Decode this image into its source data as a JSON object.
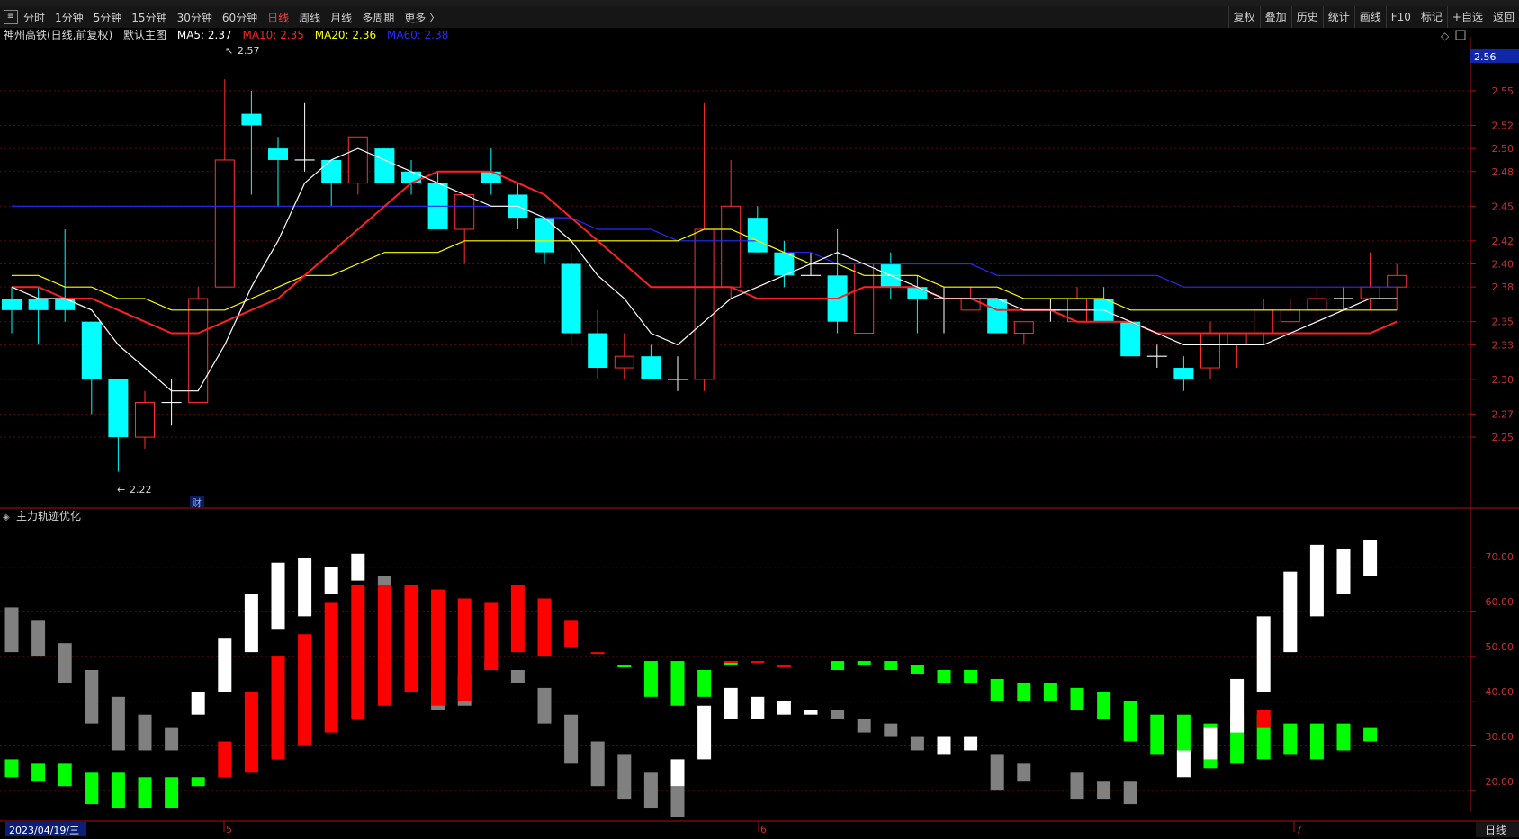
{
  "toolbar": {
    "periods": [
      "分时",
      "1分钟",
      "5分钟",
      "15分钟",
      "30分钟",
      "60分钟",
      "日线",
      "周线",
      "月线",
      "多周期",
      "更多 〉"
    ],
    "active_index": 6,
    "right_buttons": [
      "复权",
      "叠加",
      "历史",
      "统计",
      "画线",
      "F10",
      "标记",
      "+自选",
      "返回"
    ]
  },
  "main_panel": {
    "title": "神州高铁(日线,前复权)",
    "subtitle": "默认主图",
    "ma": [
      {
        "label": "MA5: 2.37",
        "color": "#ffffff"
      },
      {
        "label": "MA10: 2.35",
        "color": "#ff2020"
      },
      {
        "label": "MA20: 2.36",
        "color": "#ffff00"
      },
      {
        "label": "MA60: 2.38",
        "color": "#2a2aff"
      }
    ],
    "price_tag": "2.56",
    "high_label": "2.57",
    "low_label": "2.22",
    "fin_marker": "财",
    "top_right_icons": [
      "diamond-icon",
      "restore-icon"
    ]
  },
  "sub_panel": {
    "title": "主力轨迹优化",
    "y_ticks": [
      "70.00",
      "60.00",
      "50.00",
      "40.00",
      "30.00",
      "20.00"
    ]
  },
  "bottom_bar": {
    "date": "2023/04/19/三",
    "month_marks": [
      "5",
      "6",
      "7"
    ],
    "period_label": "日线"
  },
  "colors": {
    "up": "#ff3030",
    "down": "#00ffff",
    "ma5": "#ffffff",
    "ma10": "#ff2020",
    "ma20": "#ffff00",
    "ma60": "#2a2aff",
    "axis": "#b01010",
    "red_bar": "#ff0000",
    "green_bar": "#00ff00",
    "gray_bar": "#808080",
    "white_bar": "#ffffff"
  },
  "chart_data": [
    {
      "type": "candlestick",
      "title": "神州高铁(日线,前复权)",
      "y_ticks": [
        2.55,
        2.52,
        2.5,
        2.48,
        2.45,
        2.42,
        2.4,
        2.38,
        2.35,
        2.33,
        2.3,
        2.27,
        2.25
      ],
      "ylim": [
        2.215,
        2.592
      ],
      "candles": [
        [
          2.37,
          2.36,
          2.38,
          2.34
        ],
        [
          2.37,
          2.36,
          2.38,
          2.33
        ],
        [
          2.37,
          2.36,
          2.43,
          2.35
        ],
        [
          2.35,
          2.3,
          2.35,
          2.27
        ],
        [
          2.3,
          2.25,
          2.3,
          2.22
        ],
        [
          2.25,
          2.28,
          2.29,
          2.24
        ],
        [
          2.28,
          2.28,
          2.3,
          2.26
        ],
        [
          2.28,
          2.37,
          2.38,
          2.28
        ],
        [
          2.38,
          2.49,
          2.56,
          2.38
        ],
        [
          2.53,
          2.52,
          2.55,
          2.46
        ],
        [
          2.5,
          2.49,
          2.51,
          2.45
        ],
        [
          2.49,
          2.49,
          2.54,
          2.48
        ],
        [
          2.49,
          2.47,
          2.49,
          2.45
        ],
        [
          2.47,
          2.51,
          2.51,
          2.46
        ],
        [
          2.5,
          2.47,
          2.5,
          2.47
        ],
        [
          2.48,
          2.47,
          2.49,
          2.46
        ],
        [
          2.47,
          2.43,
          2.48,
          2.43
        ],
        [
          2.43,
          2.46,
          2.46,
          2.4
        ],
        [
          2.48,
          2.47,
          2.5,
          2.46
        ],
        [
          2.46,
          2.44,
          2.47,
          2.43
        ],
        [
          2.44,
          2.41,
          2.44,
          2.4
        ],
        [
          2.4,
          2.34,
          2.41,
          2.33
        ],
        [
          2.34,
          2.31,
          2.36,
          2.3
        ],
        [
          2.31,
          2.32,
          2.34,
          2.3
        ],
        [
          2.32,
          2.3,
          2.33,
          2.3
        ],
        [
          2.3,
          2.3,
          2.32,
          2.29
        ],
        [
          2.3,
          2.43,
          2.54,
          2.29
        ],
        [
          2.38,
          2.45,
          2.49,
          2.37
        ],
        [
          2.44,
          2.41,
          2.45,
          2.41
        ],
        [
          2.41,
          2.39,
          2.42,
          2.38
        ],
        [
          2.39,
          2.39,
          2.41,
          2.39
        ],
        [
          2.39,
          2.35,
          2.43,
          2.34
        ],
        [
          2.34,
          2.4,
          2.4,
          2.34
        ],
        [
          2.4,
          2.38,
          2.41,
          2.37
        ],
        [
          2.38,
          2.37,
          2.39,
          2.34
        ],
        [
          2.37,
          2.37,
          2.38,
          2.34
        ],
        [
          2.36,
          2.37,
          2.38,
          2.36
        ],
        [
          2.37,
          2.34,
          2.37,
          2.34
        ],
        [
          2.34,
          2.35,
          2.35,
          2.33
        ],
        [
          2.36,
          2.36,
          2.37,
          2.35
        ],
        [
          2.35,
          2.37,
          2.38,
          2.35
        ],
        [
          2.37,
          2.35,
          2.38,
          2.35
        ],
        [
          2.35,
          2.32,
          2.35,
          2.32
        ],
        [
          2.32,
          2.32,
          2.33,
          2.31
        ],
        [
          2.31,
          2.3,
          2.32,
          2.29
        ],
        [
          2.31,
          2.34,
          2.35,
          2.3
        ],
        [
          2.33,
          2.34,
          2.34,
          2.31
        ],
        [
          2.34,
          2.36,
          2.37,
          2.33
        ],
        [
          2.35,
          2.36,
          2.37,
          2.35
        ],
        [
          2.36,
          2.37,
          2.38,
          2.35
        ],
        [
          2.37,
          2.37,
          2.38,
          2.36
        ],
        [
          2.37,
          2.38,
          2.41,
          2.36
        ],
        [
          2.38,
          2.39,
          2.4,
          2.36
        ]
      ],
      "ma5": [
        2.38,
        2.37,
        2.37,
        2.36,
        2.33,
        2.31,
        2.29,
        2.29,
        2.33,
        2.38,
        2.42,
        2.47,
        2.49,
        2.5,
        2.49,
        2.48,
        2.47,
        2.46,
        2.45,
        2.45,
        2.44,
        2.42,
        2.39,
        2.37,
        2.34,
        2.33,
        2.35,
        2.37,
        2.38,
        2.39,
        2.4,
        2.41,
        2.4,
        2.39,
        2.38,
        2.37,
        2.37,
        2.37,
        2.36,
        2.36,
        2.36,
        2.36,
        2.35,
        2.34,
        2.33,
        2.33,
        2.33,
        2.33,
        2.34,
        2.35,
        2.36,
        2.37,
        2.37
      ],
      "ma10": [
        2.38,
        2.38,
        2.37,
        2.37,
        2.36,
        2.35,
        2.34,
        2.34,
        2.35,
        2.36,
        2.37,
        2.39,
        2.41,
        2.43,
        2.45,
        2.47,
        2.48,
        2.48,
        2.48,
        2.47,
        2.46,
        2.44,
        2.42,
        2.4,
        2.38,
        2.38,
        2.38,
        2.38,
        2.37,
        2.37,
        2.37,
        2.37,
        2.38,
        2.38,
        2.38,
        2.37,
        2.37,
        2.36,
        2.36,
        2.36,
        2.35,
        2.35,
        2.35,
        2.34,
        2.34,
        2.34,
        2.34,
        2.34,
        2.34,
        2.34,
        2.34,
        2.34,
        2.35
      ],
      "ma20": [
        2.39,
        2.39,
        2.38,
        2.38,
        2.37,
        2.37,
        2.36,
        2.36,
        2.36,
        2.37,
        2.38,
        2.39,
        2.39,
        2.4,
        2.41,
        2.41,
        2.41,
        2.42,
        2.42,
        2.42,
        2.42,
        2.42,
        2.42,
        2.42,
        2.42,
        2.42,
        2.43,
        2.43,
        2.42,
        2.41,
        2.4,
        2.4,
        2.39,
        2.39,
        2.39,
        2.38,
        2.38,
        2.38,
        2.37,
        2.37,
        2.37,
        2.37,
        2.36,
        2.36,
        2.36,
        2.36,
        2.36,
        2.36,
        2.36,
        2.36,
        2.36,
        2.36,
        2.36
      ],
      "ma60": [
        2.45,
        2.45,
        2.45,
        2.45,
        2.45,
        2.45,
        2.45,
        2.45,
        2.45,
        2.45,
        2.45,
        2.45,
        2.45,
        2.45,
        2.45,
        2.45,
        2.45,
        2.45,
        2.45,
        2.45,
        2.44,
        2.44,
        2.43,
        2.43,
        2.43,
        2.42,
        2.42,
        2.42,
        2.42,
        2.41,
        2.41,
        2.4,
        2.4,
        2.4,
        2.4,
        2.4,
        2.4,
        2.39,
        2.39,
        2.39,
        2.39,
        2.39,
        2.39,
        2.39,
        2.38,
        2.38,
        2.38,
        2.38,
        2.38,
        2.38,
        2.38,
        2.38,
        2.38
      ]
    },
    {
      "type": "bar",
      "title": "主力轨迹优化",
      "ylim": [
        14,
        80
      ],
      "series": [
        {
          "color": "gray",
          "values": [
            [
              51,
              61
            ],
            [
              50,
              58
            ],
            [
              44,
              53
            ],
            [
              35,
              47
            ],
            [
              29,
              41
            ],
            [
              29,
              37
            ],
            [
              29,
              34
            ],
            null,
            null,
            null,
            null,
            null,
            null,
            null,
            [
              66,
              68
            ],
            null,
            [
              38,
              43
            ],
            [
              39,
              46
            ],
            [
              47,
              49
            ],
            [
              44,
              47
            ],
            [
              35,
              43
            ],
            [
              26,
              37
            ],
            [
              21,
              31
            ],
            [
              18,
              28
            ],
            [
              16,
              24
            ],
            [
              14,
              21
            ],
            null,
            null,
            null,
            null,
            null,
            [
              36,
              38
            ],
            [
              33,
              36
            ],
            [
              32,
              35
            ],
            [
              29,
              32
            ],
            [
              30,
              32
            ],
            null,
            [
              20,
              28
            ],
            [
              22,
              26
            ],
            null,
            [
              18,
              24
            ],
            [
              18,
              22
            ],
            [
              17,
              22
            ],
            null,
            null,
            null,
            null,
            null,
            null,
            null,
            null,
            null,
            null
          ]
        },
        {
          "color": "green",
          "values": [
            [
              23,
              27
            ],
            [
              22,
              26
            ],
            [
              21,
              26
            ],
            [
              17,
              24
            ],
            [
              16,
              24
            ],
            [
              16,
              23
            ],
            [
              16,
              23
            ],
            [
              21,
              23
            ],
            null,
            null,
            null,
            null,
            null,
            null,
            null,
            null,
            null,
            null,
            null,
            null,
            null,
            null,
            null,
            48,
            [
              41,
              49
            ],
            [
              39,
              49
            ],
            [
              41,
              47
            ],
            [
              48,
              49
            ],
            null,
            null,
            null,
            [
              47,
              49
            ],
            [
              48,
              49
            ],
            [
              47,
              49
            ],
            [
              46,
              48
            ],
            [
              44,
              47
            ],
            [
              44,
              47
            ],
            [
              40,
              45
            ],
            [
              40,
              44
            ],
            [
              40,
              44
            ],
            [
              38,
              43
            ],
            [
              36,
              42
            ],
            [
              31,
              40
            ],
            [
              28,
              37
            ],
            [
              27,
              37
            ],
            [
              25,
              35
            ],
            [
              26,
              37
            ],
            [
              27,
              37
            ],
            [
              28,
              35
            ],
            [
              27,
              35
            ],
            [
              29,
              35
            ],
            [
              31,
              34
            ]
          ]
        },
        {
          "color": "red",
          "values": [
            null,
            null,
            null,
            null,
            null,
            null,
            null,
            null,
            [
              23,
              31
            ],
            [
              24,
              42
            ],
            [
              27,
              50
            ],
            [
              30,
              55
            ],
            [
              33,
              62
            ],
            [
              36,
              66
            ],
            [
              39,
              66
            ],
            [
              42,
              66
            ],
            [
              39,
              65
            ],
            [
              40,
              63
            ],
            [
              47,
              62
            ],
            [
              51,
              66
            ],
            [
              50,
              63
            ],
            [
              52,
              58
            ],
            [
              51,
              51
            ],
            null,
            null,
            null,
            null,
            [
              49,
              49
            ],
            [
              49,
              49
            ],
            [
              48,
              48
            ],
            null,
            null,
            null,
            null,
            null,
            null,
            null,
            null,
            null,
            null,
            null,
            null,
            null,
            null,
            null,
            null,
            null,
            [
              34,
              38
            ],
            null,
            null,
            null,
            null,
            null
          ]
        },
        {
          "color": "white",
          "values": [
            null,
            null,
            null,
            null,
            null,
            null,
            null,
            [
              37,
              42
            ],
            [
              42,
              54
            ],
            [
              51,
              64
            ],
            [
              56,
              71
            ],
            [
              59,
              72
            ],
            [
              64,
              70
            ],
            [
              67,
              73
            ],
            null,
            null,
            null,
            null,
            null,
            null,
            null,
            null,
            null,
            null,
            null,
            [
              21,
              27
            ],
            [
              27,
              39
            ],
            [
              36,
              43
            ],
            [
              36,
              41
            ],
            [
              37,
              40
            ],
            [
              37,
              38
            ],
            null,
            null,
            null,
            null,
            [
              28,
              32
            ],
            [
              29,
              32
            ],
            null,
            null,
            null,
            null,
            null,
            null,
            null,
            [
              23,
              29
            ],
            [
              27,
              34
            ],
            [
              33,
              45
            ],
            [
              42,
              59
            ],
            [
              51,
              69
            ],
            [
              59,
              75
            ],
            [
              64,
              74
            ],
            [
              68,
              76
            ]
          ]
        }
      ]
    }
  ]
}
